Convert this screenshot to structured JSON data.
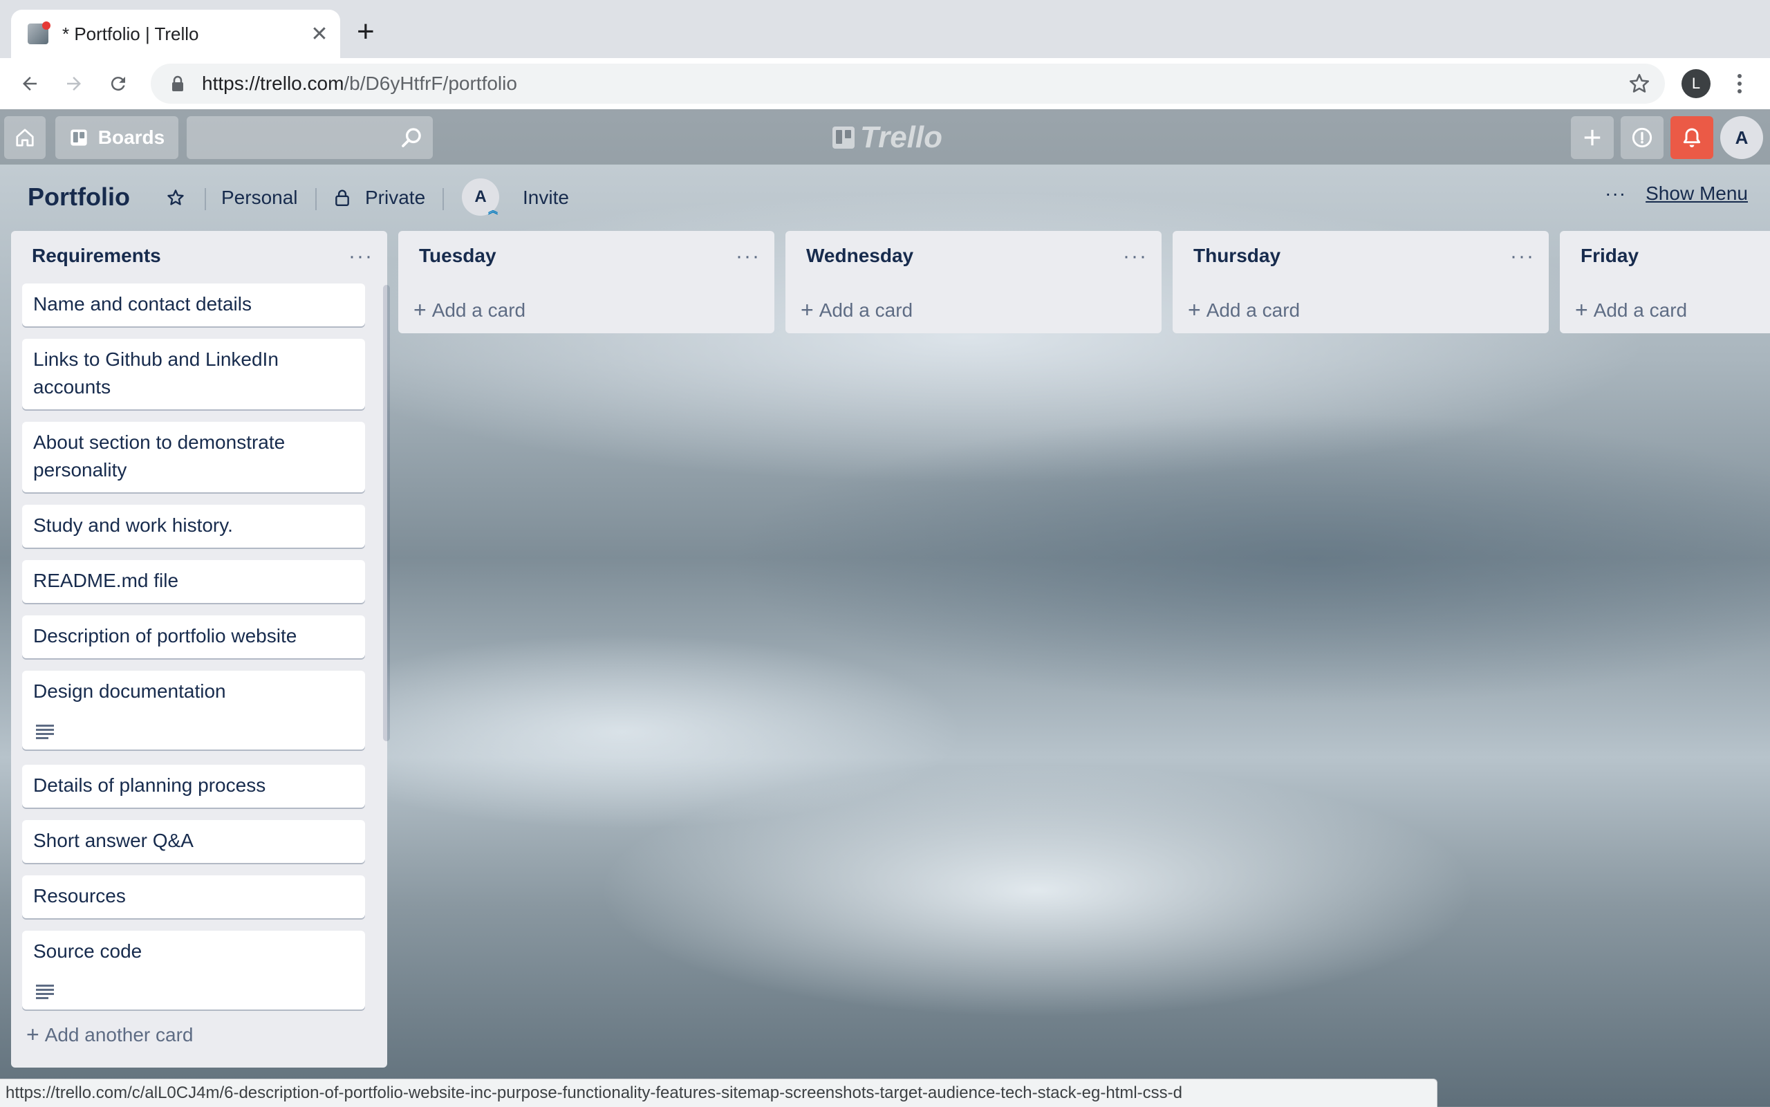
{
  "browser": {
    "tab_title": "* Portfolio | Trello",
    "url_host": "https://trello.com",
    "url_path": "/b/D6yHtfrF/portfolio",
    "profile_initial": "L"
  },
  "header": {
    "boards_label": "Boards",
    "logo_text": "Trello",
    "avatar_initial": "A",
    "bell_color": "#eb5a46"
  },
  "board": {
    "title": "Portfolio",
    "team": "Personal",
    "visibility": "Private",
    "member_initial": "A",
    "invite": "Invite",
    "show_menu": "Show Menu",
    "menu_dots": "···"
  },
  "lists": [
    {
      "title": "Requirements",
      "menu": "···",
      "cards": [
        {
          "text": "Name and contact details"
        },
        {
          "text": "Links to Github and LinkedIn accounts"
        },
        {
          "text": "About section to demonstrate personality"
        },
        {
          "text": "Study and work history."
        },
        {
          "text": "README.md file"
        },
        {
          "text": "Description of portfolio website"
        },
        {
          "text": "Design documentation",
          "has_description": true
        },
        {
          "text": "Details of planning process"
        },
        {
          "text": "Short answer Q&A"
        },
        {
          "text": "Resources"
        },
        {
          "text": "Source code",
          "has_description": true
        }
      ],
      "add_label": "Add another card"
    },
    {
      "title": "Tuesday",
      "menu": "···",
      "add_label": "Add a card"
    },
    {
      "title": "Wednesday",
      "menu": "···",
      "add_label": "Add a card"
    },
    {
      "title": "Thursday",
      "menu": "···",
      "add_label": "Add a card"
    },
    {
      "title": "Friday",
      "add_label": "Add a card"
    }
  ],
  "status_url": "https://trello.com/c/alL0CJ4m/6-description-of-portfolio-website-inc-purpose-functionality-features-sitemap-screenshots-target-audience-tech-stack-eg-html-css-d"
}
